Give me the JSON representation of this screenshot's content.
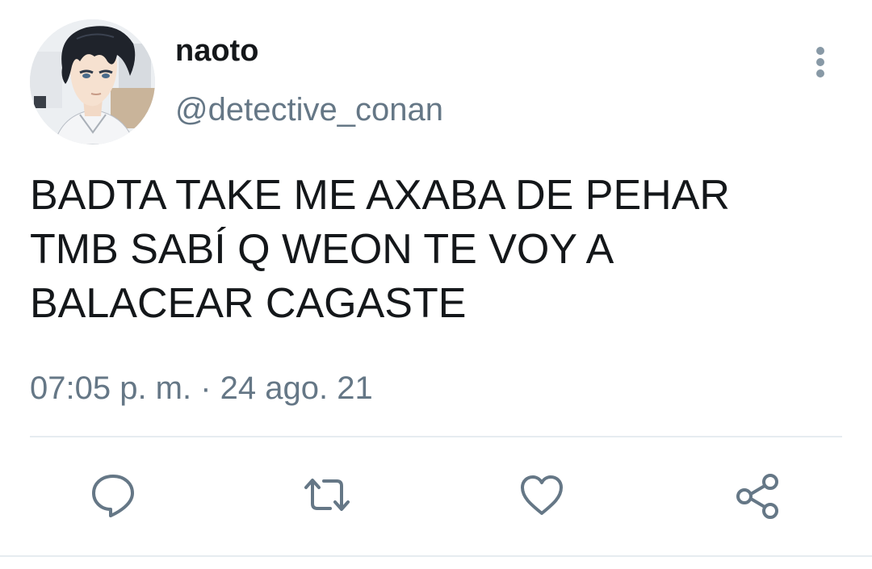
{
  "tweet": {
    "author": {
      "display_name": "naoto",
      "handle": "@detective_conan",
      "avatar": "anime-character-avatar"
    },
    "text_lines": [
      "BADTA TAKE ME AXABA DE PEHAR",
      "TMB SABÍ Q WEON TE VOY A",
      "BALACEAR CAGASTE"
    ],
    "timestamp": "07:05 p. m. · 24 ago. 21"
  },
  "icons": {
    "more": "more-vertical-icon",
    "reply": "reply-icon",
    "retweet": "retweet-icon",
    "like": "heart-icon",
    "share": "share-icon"
  },
  "colors": {
    "text": "#14171a",
    "secondary": "#657786",
    "icon": "#657786",
    "divider": "#e6ecf0"
  }
}
